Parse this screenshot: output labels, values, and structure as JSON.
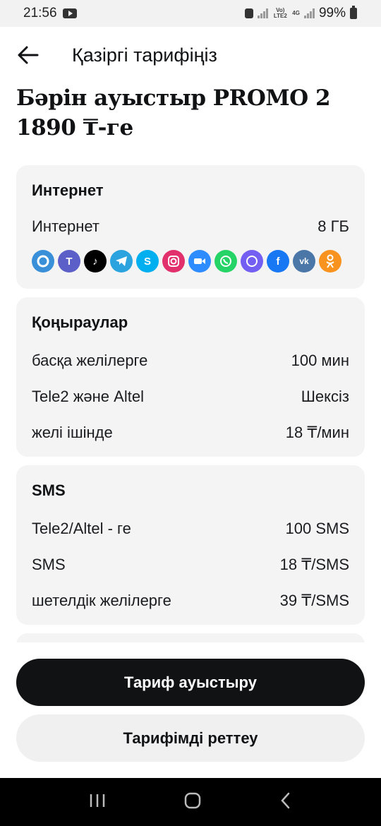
{
  "status_bar": {
    "time": "21:56",
    "network": "4G",
    "volte": "Vo) LTE2",
    "battery": "99%"
  },
  "header": {
    "title": "Қазіргі тарифіңіз"
  },
  "plan": {
    "title": "Бәрін ауыстыр PROMO 2 1890 ₸-ге"
  },
  "internet": {
    "title": "Интернет",
    "rows": [
      {
        "label": "Интернет",
        "value": "8 ГБ"
      }
    ],
    "apps": [
      {
        "name": "messenger",
        "color": "#3a8fd9"
      },
      {
        "name": "teams",
        "color": "#5b5fc7"
      },
      {
        "name": "tiktok",
        "color": "#000000"
      },
      {
        "name": "telegram",
        "color": "#2aa3de"
      },
      {
        "name": "skype",
        "color": "#00aff0"
      },
      {
        "name": "instagram",
        "color": "#e1306c"
      },
      {
        "name": "zoom",
        "color": "#2d8cff"
      },
      {
        "name": "whatsapp",
        "color": "#25d366"
      },
      {
        "name": "viber",
        "color": "#7360f2"
      },
      {
        "name": "facebook",
        "color": "#1877f2"
      },
      {
        "name": "vk",
        "color": "#4a76a8"
      },
      {
        "name": "odnoklassniki",
        "color": "#f7931e"
      }
    ]
  },
  "calls": {
    "title": "Қоңыраулар",
    "rows": [
      {
        "label": "басқа желілерге",
        "value": "100 мин"
      },
      {
        "label": "Tele2 және Altel",
        "value": "Шексіз"
      },
      {
        "label": "желі ішінде",
        "value": "18 ₸/мин"
      }
    ]
  },
  "sms": {
    "title": "SMS",
    "rows": [
      {
        "label": "Tele2/Altel - ге",
        "value": "100 SMS"
      },
      {
        "label": "SMS",
        "value": "18 ₸/SMS"
      },
      {
        "label": "шетелдік желілерге",
        "value": "39 ₸/SMS"
      }
    ]
  },
  "actions": {
    "change_tariff": "Тариф ауыстыру",
    "customize_tariff": "Тарифімді реттеу"
  },
  "colors": {
    "primary": "#111214",
    "card_bg": "#f4f4f5"
  }
}
